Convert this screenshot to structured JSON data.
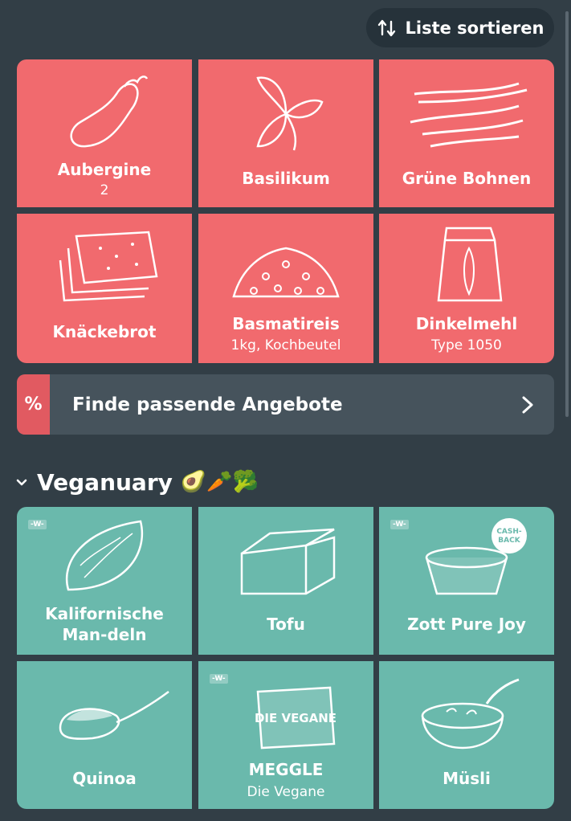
{
  "toolbar": {
    "sort_label": "Liste sortieren"
  },
  "list_items": [
    {
      "name": "Aubergine",
      "detail": "2",
      "icon": "eggplant-icon"
    },
    {
      "name": "Basilikum",
      "detail": "",
      "icon": "basil-icon"
    },
    {
      "name": "Grüne Bohnen",
      "detail": "",
      "icon": "green-beans-icon"
    },
    {
      "name": "Knäckebrot",
      "detail": "",
      "icon": "crispbread-icon"
    },
    {
      "name": "Basmatireis",
      "detail": "1kg, Kochbeutel",
      "icon": "rice-icon"
    },
    {
      "name": "Dinkelmehl",
      "detail": "Type 1050",
      "icon": "flour-bag-icon"
    }
  ],
  "offers_banner": {
    "symbol": "%",
    "label": "Finde passende Angebote"
  },
  "section": {
    "title": "Veganuary",
    "emoji": "🥑🥕🥦"
  },
  "section_items": [
    {
      "name": "Kalifornische Man-deln",
      "detail": "",
      "badge": "-W-",
      "icon": "almond-icon"
    },
    {
      "name": "Tofu",
      "detail": "",
      "badge": "",
      "icon": "tofu-icon"
    },
    {
      "name": "Zott Pure Joy",
      "detail": "",
      "badge": "-W-",
      "icon": "yogurt-cup-icon",
      "extra": "CASH-BACK"
    },
    {
      "name": "Quinoa",
      "detail": "",
      "badge": "",
      "icon": "spoon-grain-icon"
    },
    {
      "name": "MEGGLE",
      "detail": "Die Vegane",
      "badge": "-W-",
      "icon": "butter-pack-icon",
      "pack_text": "DIE VEGANE"
    },
    {
      "name": "Müsli",
      "detail": "",
      "badge": "",
      "icon": "cereal-bowl-icon"
    }
  ],
  "colors": {
    "background": "#323e46",
    "list_tile": "#f16a6e",
    "section_tile": "#6ab9ac",
    "offers_bg": "#46535c",
    "offers_accent": "#e15a61"
  }
}
